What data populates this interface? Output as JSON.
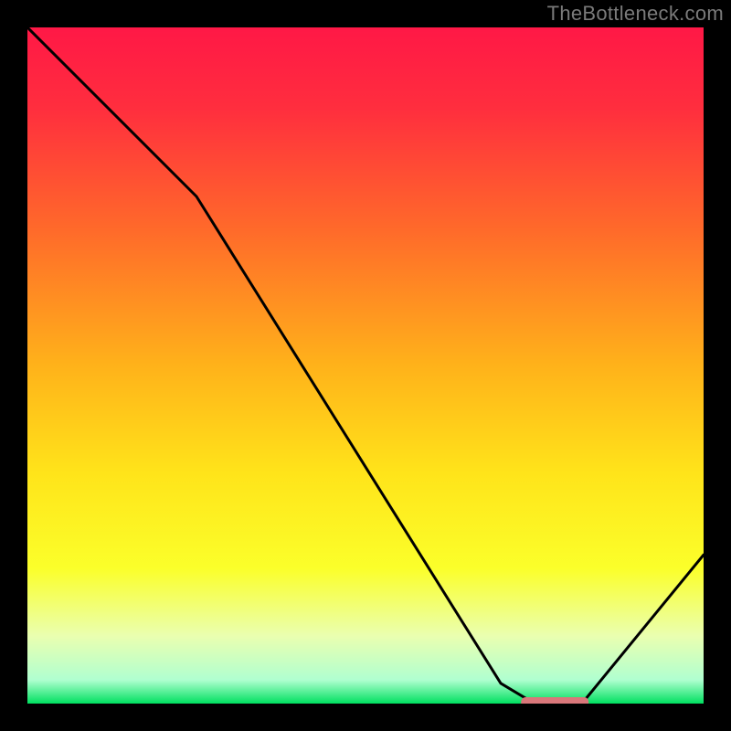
{
  "watermark": "TheBottleneck.com",
  "chart_data": {
    "type": "line",
    "title": "",
    "xlabel": "",
    "ylabel": "",
    "xlim": [
      0,
      100
    ],
    "ylim": [
      0,
      100
    ],
    "x": [
      0,
      25,
      70,
      75,
      82,
      100
    ],
    "values": [
      100,
      75,
      3,
      0,
      0,
      22
    ],
    "marker": {
      "x_start": 73,
      "x_end": 83,
      "y": 0
    },
    "gradient_stops": [
      {
        "offset": 0.0,
        "color": "#ff1846"
      },
      {
        "offset": 0.12,
        "color": "#ff2e3e"
      },
      {
        "offset": 0.3,
        "color": "#ff6a2a"
      },
      {
        "offset": 0.5,
        "color": "#ffb21a"
      },
      {
        "offset": 0.66,
        "color": "#ffe41a"
      },
      {
        "offset": 0.8,
        "color": "#fbff2a"
      },
      {
        "offset": 0.9,
        "color": "#eaffb0"
      },
      {
        "offset": 0.965,
        "color": "#b0ffd0"
      },
      {
        "offset": 1.0,
        "color": "#00e060"
      }
    ]
  }
}
